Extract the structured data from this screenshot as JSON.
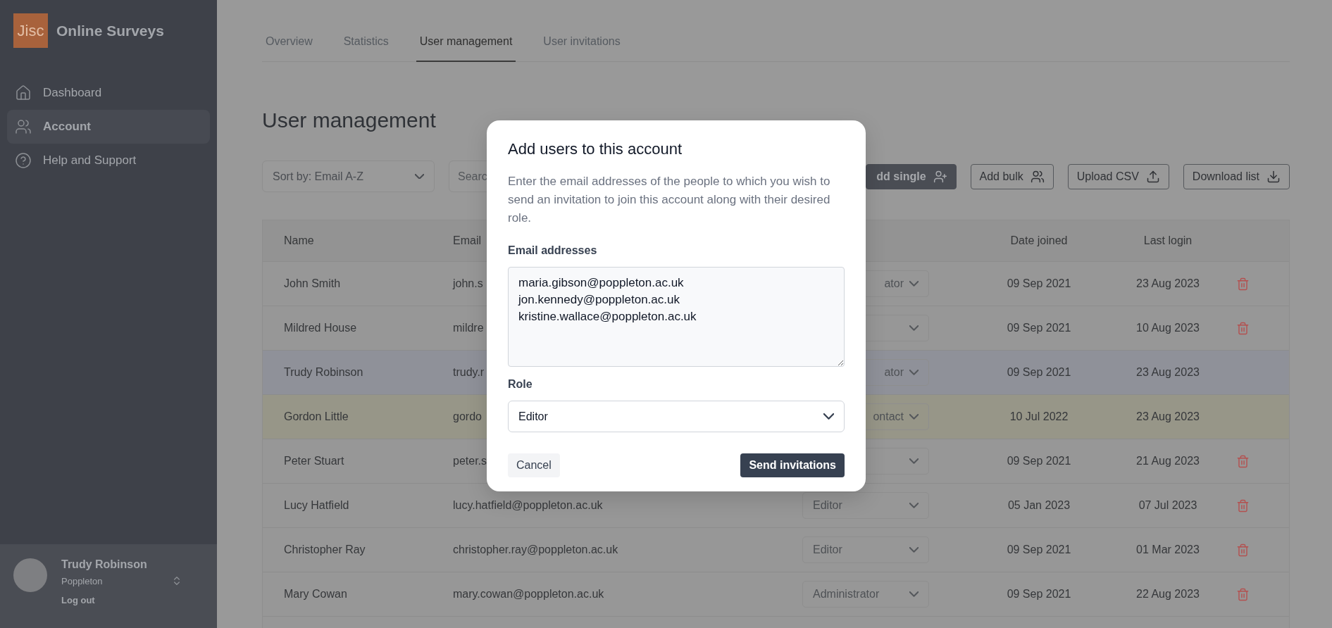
{
  "sidebar": {
    "logo": "Jisc",
    "app_name": "Online Surveys",
    "items": [
      {
        "label": "Dashboard",
        "selected": false
      },
      {
        "label": "Account",
        "selected": true
      },
      {
        "label": "Help and Support",
        "selected": false
      }
    ],
    "user": {
      "name": "Trudy Robinson",
      "org": "Poppleton",
      "logout": "Log out"
    }
  },
  "tabs": [
    {
      "label": "Overview",
      "selected": false
    },
    {
      "label": "Statistics",
      "selected": false
    },
    {
      "label": "User management",
      "selected": true
    },
    {
      "label": "User invitations",
      "selected": false
    }
  ],
  "page_title": "User management",
  "toolbar": {
    "sort": "Sort by: Email A-Z",
    "search_placeholder": "Searc",
    "buttons": [
      {
        "label": "dd single",
        "kind": "primary"
      },
      {
        "label": "Add bulk",
        "kind": "outline"
      },
      {
        "label": "Upload CSV",
        "kind": "outline"
      },
      {
        "label": "Download list",
        "kind": "outline"
      }
    ]
  },
  "table": {
    "columns": [
      "Name",
      "Email",
      "Date joined",
      "Last login"
    ],
    "rows": [
      {
        "name": "John Smith",
        "email": "john.s",
        "role": "ator",
        "role_cut": true,
        "joined": "09 Sep 2021",
        "last_login": "23 Aug 2023",
        "kind": "normal",
        "deletable": true
      },
      {
        "name": "Mildred House",
        "email": "mildre",
        "joined": "09 Sep 2021",
        "last_login": "10 Aug 2023",
        "kind": "normal",
        "deletable": true
      },
      {
        "name": "Trudy Robinson",
        "email": "trudy.r",
        "role": "ator",
        "role_cut": true,
        "joined": "09 Sep 2021",
        "last_login": "23 Aug 2023",
        "kind": "current",
        "deletable": false
      },
      {
        "name": "Gordon Little",
        "email": "gordo",
        "role": "ontact",
        "role_cut": true,
        "joined": "10 Jul 2022",
        "last_login": "23 Aug 2023",
        "kind": "contact",
        "deletable": false
      },
      {
        "name": "Peter Stuart",
        "email": "peter.s",
        "joined": "09 Sep 2021",
        "last_login": "21 Aug 2023",
        "kind": "normal",
        "deletable": true
      },
      {
        "name": "Lucy Hatfield",
        "email": "lucy.hatfield@poppleton.ac.uk",
        "role": "Editor",
        "role_cut": false,
        "joined": "05 Jan 2023",
        "last_login": "07 Jul 2023",
        "kind": "normal",
        "deletable": true
      },
      {
        "name": "Christopher Ray",
        "email": "christopher.ray@poppleton.ac.uk",
        "role": "Editor",
        "role_cut": false,
        "joined": "09 Sep 2021",
        "last_login": "01 Mar 2023",
        "kind": "normal",
        "deletable": true
      },
      {
        "name": "Mary Cowan",
        "email": "mary.cowan@poppleton.ac.uk",
        "role": "Administrator",
        "role_cut": false,
        "joined": "09 Sep 2021",
        "last_login": "22 Aug 2023",
        "kind": "normal",
        "deletable": true
      }
    ]
  },
  "dialog": {
    "title": "Add users to this account",
    "description": "Enter the email addresses of the people to which you wish to send an invitation to join this account along with their desired role.",
    "emails_label": "Email addresses",
    "emails_value": "maria.gibson@poppleton.ac.uk\njon.kennedy@poppleton.ac.uk\nkristine.wallace@poppleton.ac.uk",
    "role_label": "Role",
    "role_value": "Editor",
    "cancel": "Cancel",
    "submit": "Send invitations"
  }
}
